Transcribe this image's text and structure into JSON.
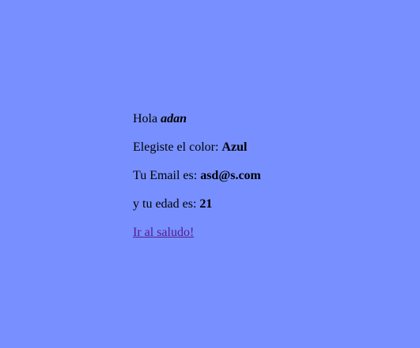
{
  "greeting": {
    "prefix": "Hola ",
    "name": "adan"
  },
  "color_line": {
    "prefix": "Elegiste el color: ",
    "value": "Azul"
  },
  "email_line": {
    "prefix": "Tu Email es: ",
    "value": "asd@s.com"
  },
  "age_line": {
    "prefix": "y tu edad es: ",
    "value": "21"
  },
  "link": {
    "label": "Ir al saludo!"
  },
  "colors": {
    "background": "#7890ff",
    "text": "#000000",
    "visited_link": "#551a8b"
  }
}
